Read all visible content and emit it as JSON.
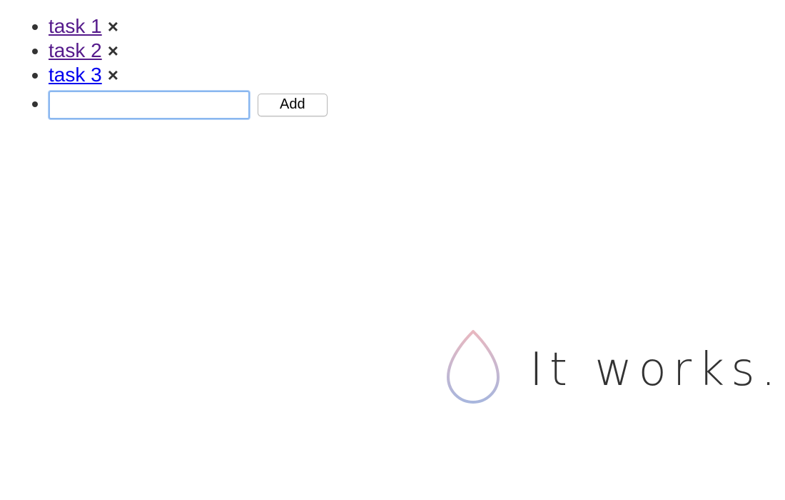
{
  "tasks": [
    {
      "label": "task 1",
      "visited": true
    },
    {
      "label": "task 2",
      "visited": true
    },
    {
      "label": "task 3",
      "visited": false
    }
  ],
  "remove_glyph": "×",
  "new_task": {
    "value": "",
    "add_label": "Add"
  },
  "brand": {
    "text": "It works.",
    "drop_gradient": [
      "#e9b8c0",
      "#a8b6dd"
    ]
  }
}
